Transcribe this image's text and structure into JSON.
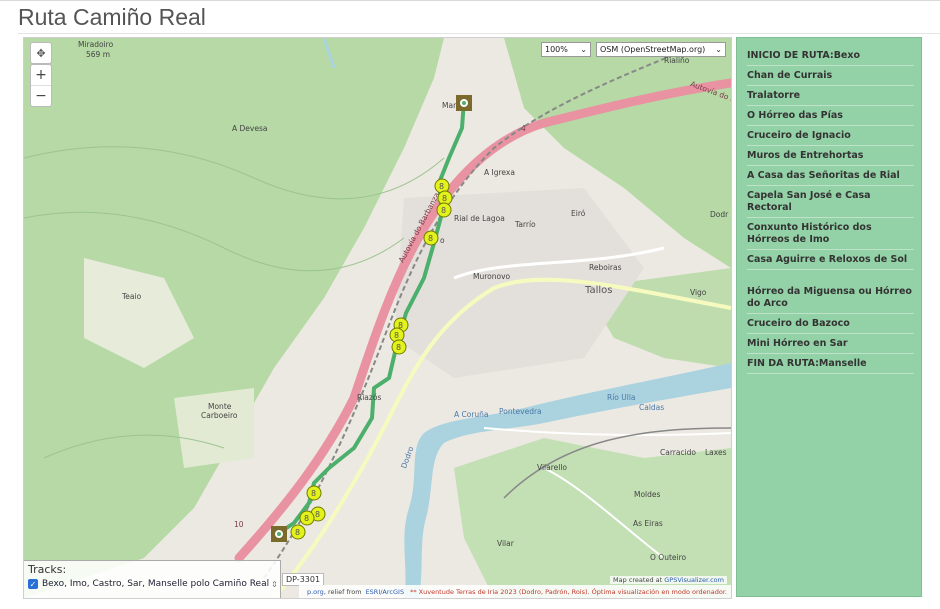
{
  "page": {
    "title": "Ruta Camiño Real"
  },
  "map": {
    "zoom_select": "100%",
    "layer_select": "OSM (OpenStreetMap.org)",
    "controls": {
      "pan": "✥",
      "zoom_in": "+",
      "zoom_out": "−"
    },
    "tracks": {
      "header": "Tracks:",
      "item": "Bexo, Imo, Castro, Sar, Manselle polo Camiño Real"
    },
    "road_label": "DP-3301",
    "attribution": {
      "part1": "p.org",
      "part2": ", relief from",
      "part3": "ESRI/ArcGIS",
      "credit": "** Xuventude Terras de Iria 2023 (Dodro, Padrón, Rois). Óptima visualización en modo ordenador.",
      "created_prefix": "Map created at",
      "created_link": "GPSVisualizer.com"
    },
    "place_labels": {
      "miradoiro": "Miradoiro",
      "miradoiro_elev": "569 m",
      "a_devesa": "A Devesa",
      "manselle": "Man",
      "rialino": "Rialiño",
      "a_igrexa": "A Igrexa",
      "rial_de_lagoa": "Rial de Lagoa",
      "tarrio": "Tarrío",
      "eiro": "Eiró",
      "dodro": "Dodr",
      "imo": "o",
      "muronovo": "Muronovo",
      "reboiras": "Reboiras",
      "tallos": "Tallos",
      "vigo": "Vigo",
      "teaio": "Teaio",
      "monte_carboeiro": "Monte",
      "monte_carboeiro_2": "Carboeiro",
      "riazos": "Riazós",
      "pontevedra": "Pontevedra",
      "a_coruna": "A Coruña",
      "rio_ulla": "Río Ulla",
      "caldas": "Caldas",
      "vilarello": "Vilarello",
      "carracido": "Carracido",
      "laxes": "Laxes",
      "moldes": "Moldes",
      "as_eiras": "As Eiras",
      "vilar": "Vilar",
      "o_outeiro": "O Outeiro",
      "autovia_barbanza": "Autovía do Barbanza",
      "autovia_ba": "Autovía do Ba",
      "dodro_road": "Dodro",
      "route_10": "10",
      "route_4": "4"
    }
  },
  "sidebar": {
    "items": [
      "INICIO DE RUTA:Bexo",
      "Chan de Currais",
      "Tralatorre",
      "O Hórreo das Pías",
      "Cruceiro de Ignacio",
      "Muros de Entrehortas",
      "A Casa das Señoritas de Rial",
      "Capela San José e Casa Rectoral",
      "Conxunto Histórico dos Hórreos de Imo",
      "Casa Aguirre e Reloxos de Sol",
      "Hórreo da Miguensa ou Hórreo do Arco",
      "Cruceiro do Bazoco",
      "Mini Hórreo en Sar",
      "FIN DA RUTA:Manselle"
    ]
  },
  "colors": {
    "forest": "#add19e",
    "motorway": "#e892a2",
    "river": "#aad3df",
    "track": "#4caf6b",
    "sidebar_bg": "#93d2a7",
    "marker": "#e3f21b"
  }
}
